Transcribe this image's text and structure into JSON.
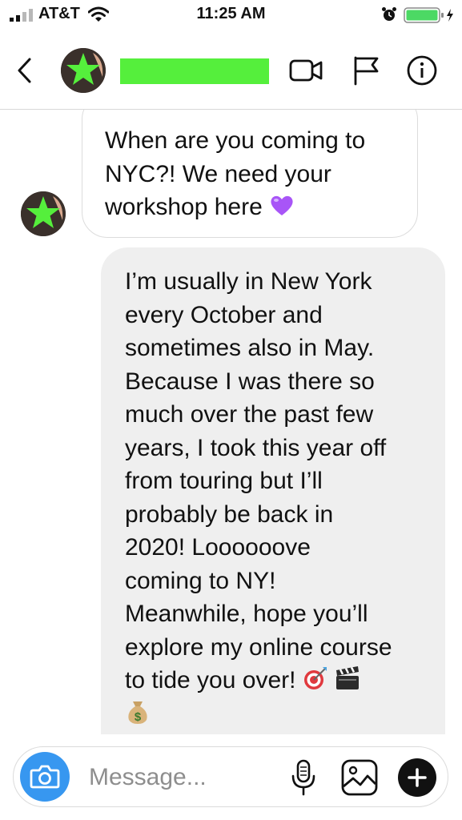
{
  "status_bar": {
    "carrier": "AT&T",
    "time": "11:25 AM",
    "battery_color": "#4cd964"
  },
  "header": {
    "back_icon": "chevron-left-icon",
    "video_icon": "video-camera-icon",
    "flag_icon": "flag-icon",
    "info_icon": "info-icon",
    "redaction_color": "#55ef3c"
  },
  "messages": [
    {
      "direction": "incoming",
      "lines": [
        "When are you coming to",
        "NYC?! We need your",
        "workshop here"
      ],
      "trailing_emoji": "purple-heart-icon"
    },
    {
      "direction": "outgoing",
      "lines": [
        "I’m usually in New York",
        "every October and",
        "sometimes also in May.",
        "Because I was there so",
        "much over the past few",
        "years, I took this year off",
        "from touring but I’ll",
        "probably be back in",
        "2020! Loooooove",
        "coming to NY!",
        "Meanwhile, hope you’ll",
        "explore my online course",
        "to tide you over!"
      ],
      "trailing_emojis": [
        "bullseye-dart-icon",
        "clapper-board-icon",
        "money-bag-icon"
      ]
    }
  ],
  "composer": {
    "placeholder": "Message...",
    "value": "",
    "accent": "#3797f0"
  }
}
